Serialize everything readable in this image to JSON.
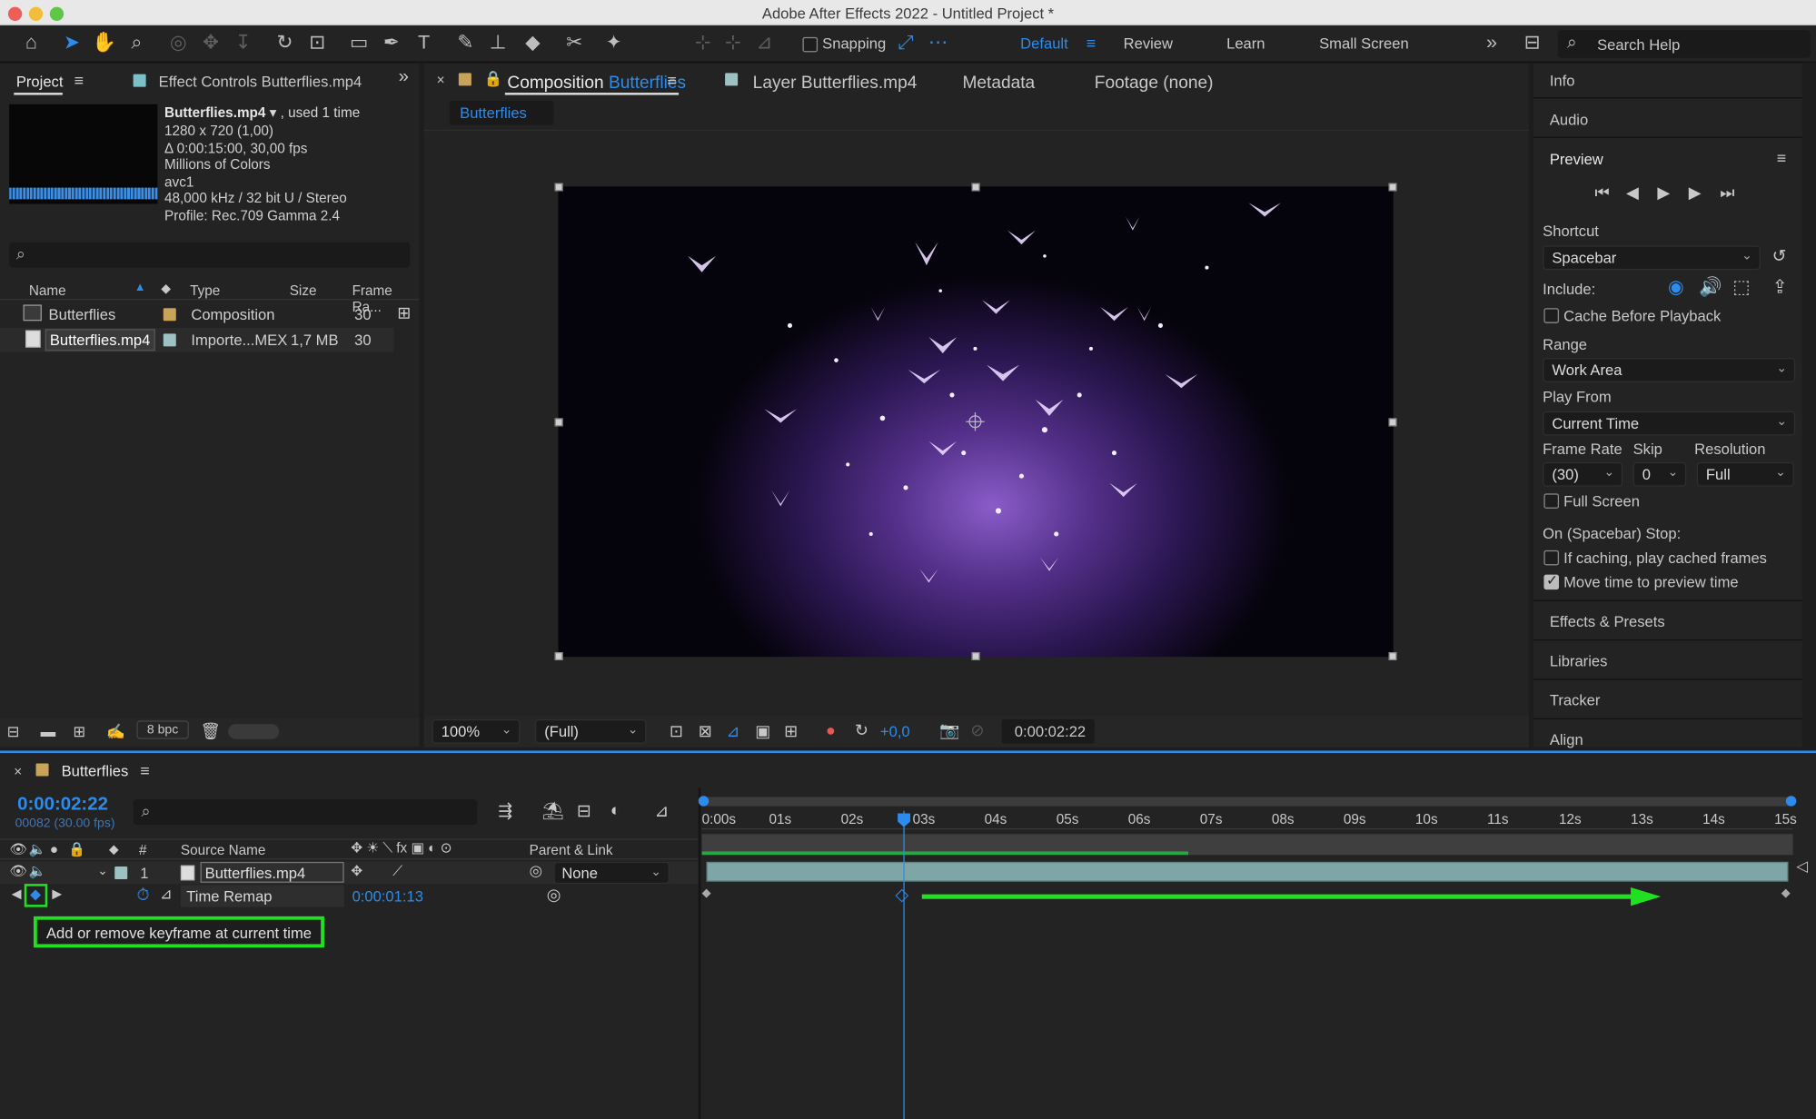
{
  "app": {
    "title": "Adobe After Effects 2022 - Untitled Project *",
    "colors": {
      "accent_blue": "#2d8ceb",
      "highlight_green": "#21e021",
      "panel": "#232323",
      "bg": "#1d1d1d"
    }
  },
  "toolbar": {
    "tools": [
      "home-icon",
      "selection-icon",
      "hand-icon",
      "zoom-icon",
      "orbit-icon",
      "pan-icon",
      "dolly-icon",
      "rotate-icon",
      "pan-behind-icon",
      "rectangle-icon",
      "pen-icon",
      "type-icon",
      "brush-icon",
      "clone-stamp-icon",
      "eraser-icon",
      "roto-brush-icon",
      "puppet-pin-icon"
    ],
    "snapping": "Snapping",
    "workspaces": [
      "Default",
      "Review",
      "Learn",
      "Small Screen"
    ],
    "active_workspace": "Default",
    "search_placeholder": "Search Help"
  },
  "project_panel": {
    "tabs": [
      "Project",
      "Effect Controls Butterflies.mp4"
    ],
    "item_name": "Butterflies.mp4",
    "item_used": ", used 1 time",
    "info_lines": [
      "1280 x 720 (1,00)",
      "Δ 0:00:15:00, 30,00 fps",
      "Millions of Colors",
      "avc1",
      "48,000 kHz / 32 bit U / Stereo",
      "Profile: Rec.709 Gamma 2.4"
    ],
    "columns": [
      "Name",
      "Type",
      "Size",
      "Frame Ra..."
    ],
    "rows": [
      {
        "name": "Butterflies",
        "type": "Composition",
        "size": "",
        "fps": "30"
      },
      {
        "name": "Butterflies.mp4",
        "type": "Importe...MEX",
        "size": "1,7 MB",
        "fps": "30"
      }
    ],
    "bpc": "8 bpc"
  },
  "viewer": {
    "tabs": [
      "Composition",
      "Butterflies",
      "Layer Butterflies.mp4",
      "Metadata",
      "Footage (none)"
    ],
    "breadcrumb": "Butterflies",
    "zoom": "100%",
    "resolution": "(Full)",
    "exposure": "+0,0",
    "timecode": "0:00:02:22"
  },
  "right_panel": {
    "sections_top": [
      "Info",
      "Audio",
      "Preview"
    ],
    "shortcut_label": "Shortcut",
    "shortcut_value": "Spacebar",
    "include_label": "Include:",
    "cache_label": "Cache Before Playback",
    "range_label": "Range",
    "range_value": "Work Area",
    "play_from_label": "Play From",
    "play_from_value": "Current Time",
    "frame_rate_label": "Frame Rate",
    "frame_rate_value": "(30)",
    "skip_label": "Skip",
    "skip_value": "0",
    "resolution_label": "Resolution",
    "resolution_value": "Full",
    "full_screen_label": "Full Screen",
    "stop_label": "On (Spacebar) Stop:",
    "if_caching_label": "If caching, play cached frames",
    "move_time_label": "Move time to preview time",
    "sections_bottom": [
      "Effects & Presets",
      "Libraries",
      "Tracker",
      "Align"
    ]
  },
  "timeline": {
    "comp_name": "Butterflies",
    "current_time": "0:00:02:22",
    "frame_info": "00082 (30.00 fps)",
    "col_hash": "#",
    "col_source": "Source Name",
    "col_parent": "Parent & Link",
    "layer_num": "1",
    "layer_name": "Butterflies.mp4",
    "parent_value": "None",
    "property_name": "Time Remap",
    "property_value": "0:00:01:13",
    "tooltip": "Add or remove keyframe at current time",
    "ruler_labels": [
      "0:00s",
      "01s",
      "02s",
      "03s",
      "04s",
      "05s",
      "06s",
      "07s",
      "08s",
      "09s",
      "10s",
      "11s",
      "12s",
      "13s",
      "14s",
      "15s"
    ]
  }
}
